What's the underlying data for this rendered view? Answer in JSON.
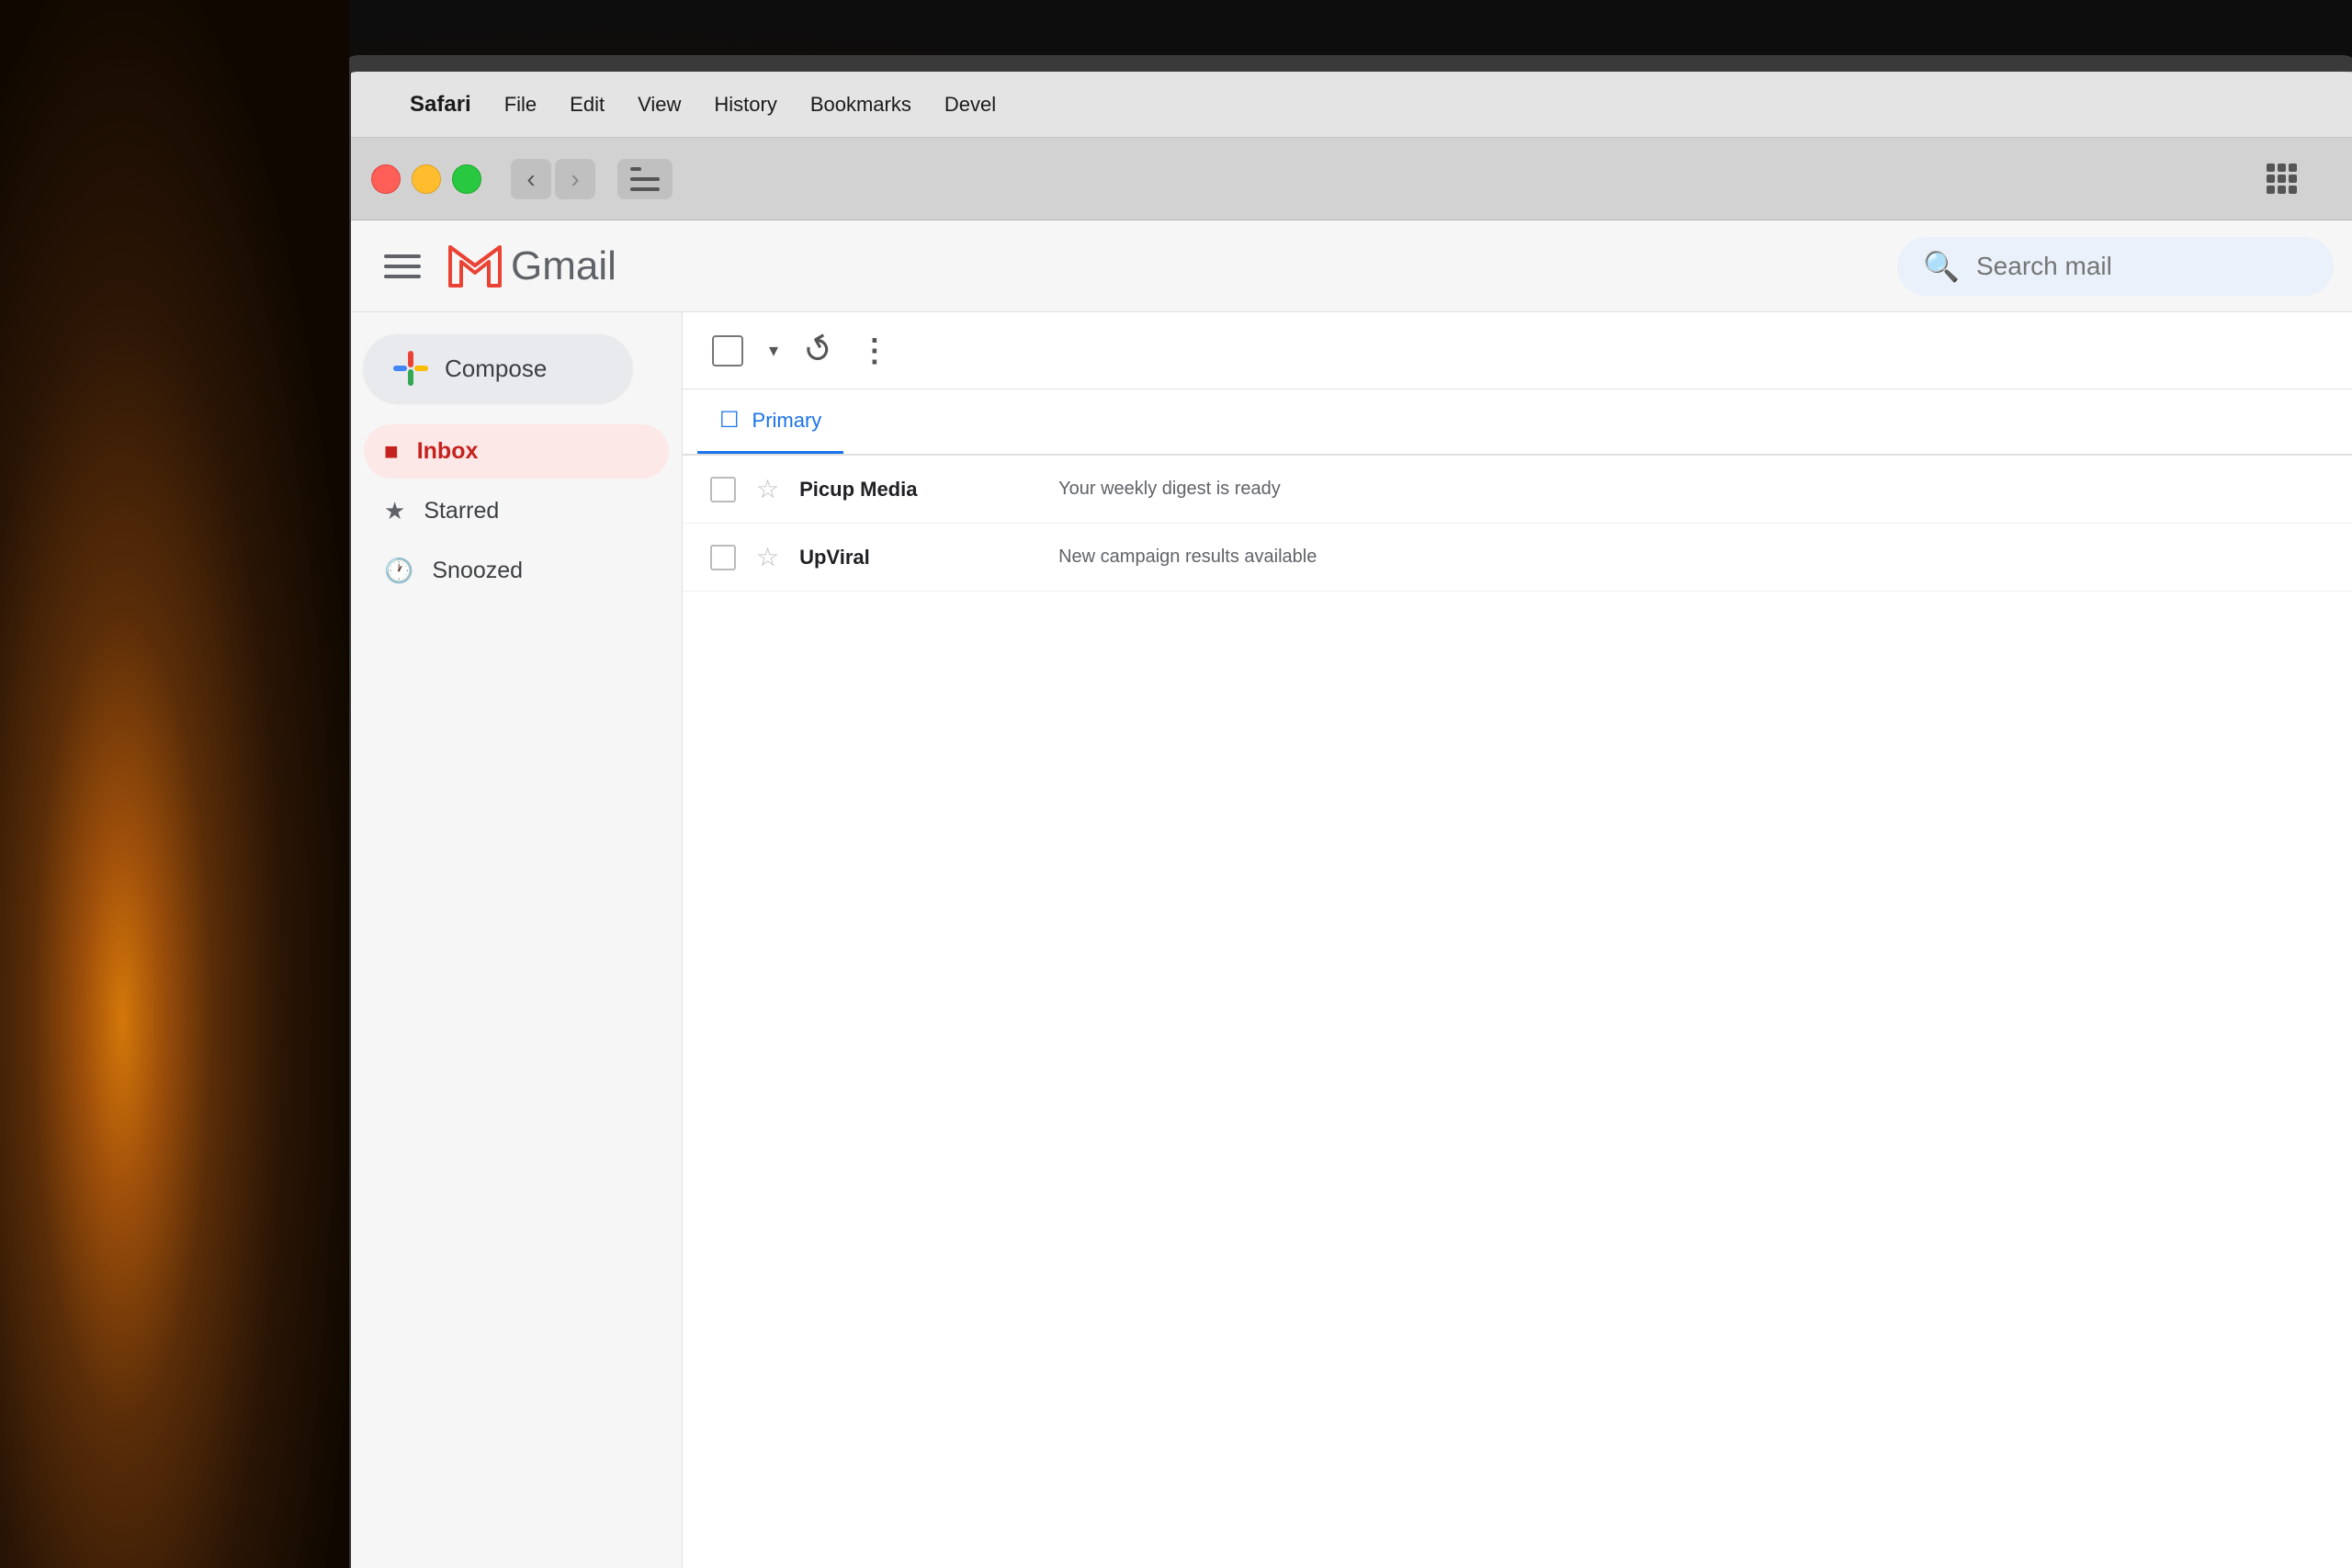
{
  "background": {
    "color": "#1a1a1a"
  },
  "menubar": {
    "apple_label": "",
    "safari_label": "Safari",
    "file_label": "File",
    "edit_label": "Edit",
    "view_label": "View",
    "history_label": "History",
    "bookmarks_label": "Bookmarks",
    "develop_label": "Devel"
  },
  "browser": {
    "back_label": "‹",
    "forward_label": "›",
    "grid_tooltip": "grid-view"
  },
  "gmail": {
    "logo_text": "Gmail",
    "m_color": "#EA4335",
    "search_placeholder": "Search mail",
    "compose_label": "Compose",
    "nav_items": [
      {
        "id": "inbox",
        "label": "Inbox",
        "icon": "inbox",
        "active": true
      },
      {
        "id": "starred",
        "label": "Starred",
        "icon": "star",
        "active": false
      },
      {
        "id": "snoozed",
        "label": "Snoozed",
        "icon": "clock",
        "active": false
      }
    ],
    "tabs": [
      {
        "id": "primary",
        "label": "Primary",
        "icon": "☐",
        "active": true
      }
    ],
    "toolbar": {
      "more_dots": "⋮"
    },
    "emails": [
      {
        "sender": "Picup Media",
        "subject": "Your weekly digest is ready",
        "starred": false
      },
      {
        "sender": "UpViral",
        "subject": "New campaign results available",
        "starred": false
      }
    ]
  },
  "colors": {
    "accent_red": "#EA4335",
    "accent_blue": "#1a73e8",
    "inbox_active_bg": "#fce8e6",
    "inbox_active_text": "#c5221f",
    "search_bg": "#eaf1fb",
    "compose_bg": "#e8eaed",
    "gmail_bg": "#f6f6f6",
    "compose_plus_red": "#EA4335",
    "compose_plus_blue": "#4285F4",
    "compose_plus_green": "#34A853",
    "compose_plus_yellow": "#FBBC05"
  }
}
